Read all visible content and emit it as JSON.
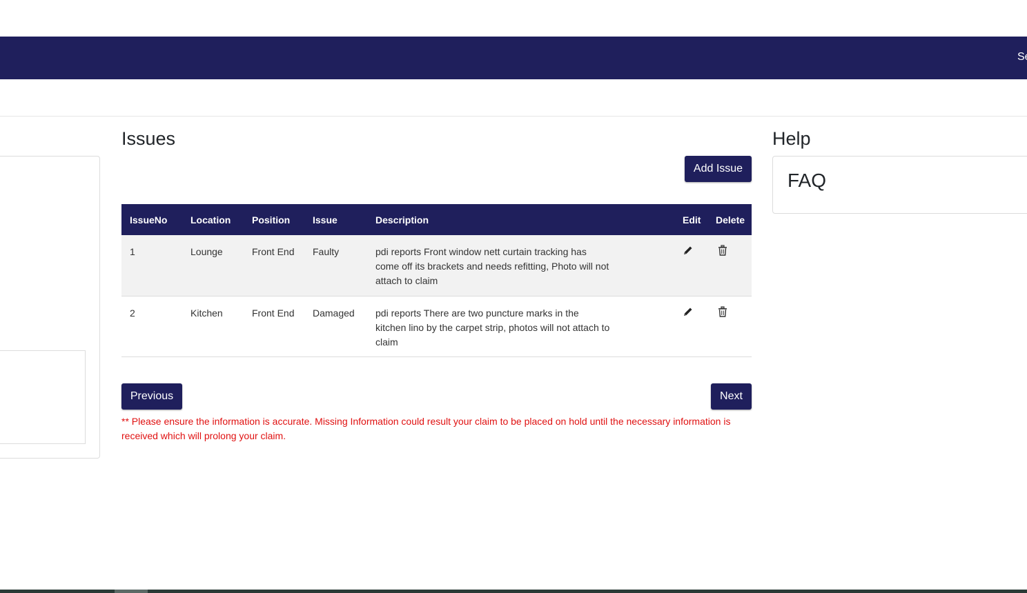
{
  "navbar": {
    "cut_text": "Se"
  },
  "issues_title": "Issues",
  "add_issue_label": "Add Issue",
  "table": {
    "headers": [
      "IssueNo",
      "Location",
      "Position",
      "Issue",
      "Description",
      "Edit",
      "Delete"
    ],
    "rows": [
      {
        "no": "1",
        "location": "Lounge",
        "position": "Front End",
        "issue": "Faulty",
        "description": "pdi reports Front window nett curtain tracking has come off its brackets and needs refitting, Photo will not attach to claim"
      },
      {
        "no": "2",
        "location": "Kitchen",
        "position": "Front End",
        "issue": "Damaged",
        "description": "pdi reports There are two puncture marks in the kitchen lino by the carpet strip, photos will not attach to claim"
      }
    ]
  },
  "nav_buttons": {
    "previous": "Previous",
    "next": "Next"
  },
  "warning_text": "** Please ensure the information is accurate. Missing Information could result your claim to be placed on hold until the necessary information is received which will prolong your claim.",
  "help": {
    "title": "Help",
    "faq": "FAQ"
  },
  "icons": {
    "edit": "pencil-icon",
    "delete": "trash-icon"
  },
  "colors": {
    "brand": "#1f1f5c",
    "warning": "#e01010"
  }
}
